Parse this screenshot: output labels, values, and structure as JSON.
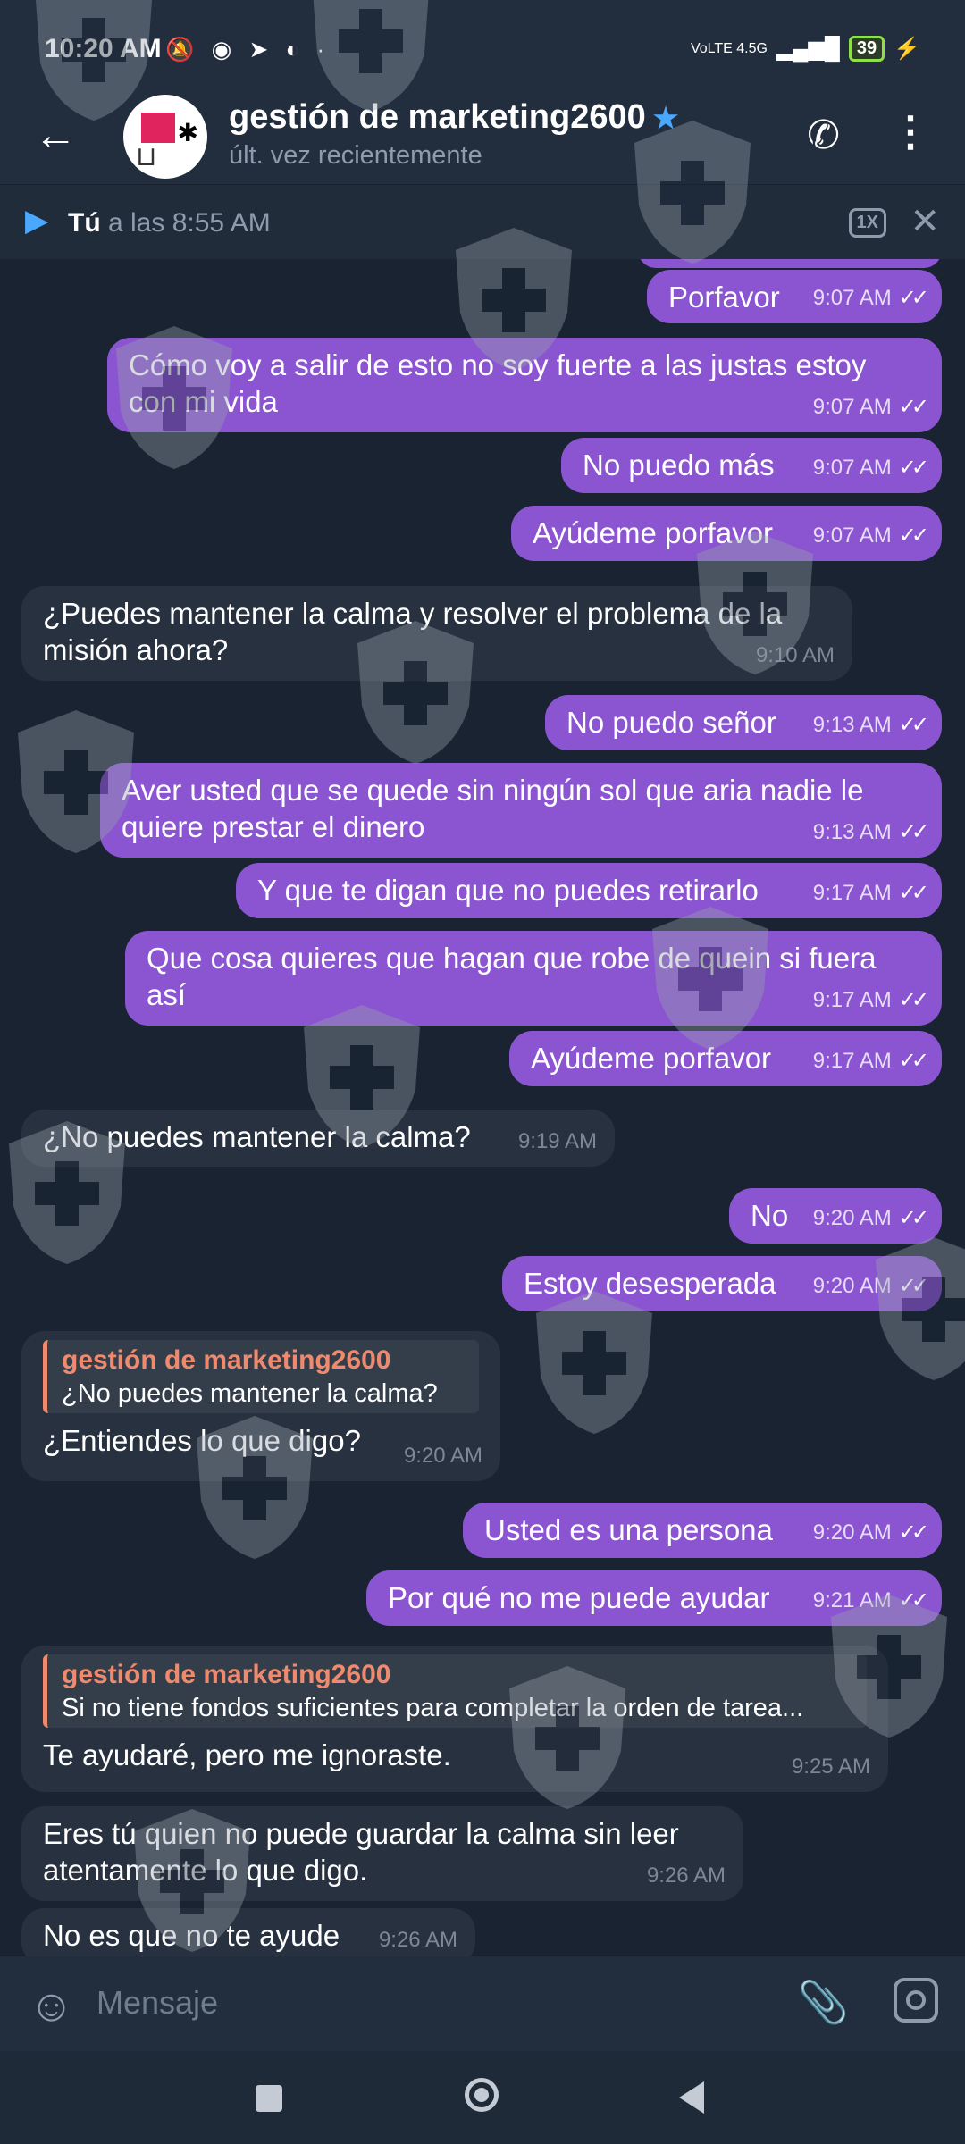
{
  "status_bar": {
    "time": "10:20 AM",
    "icons": "🔕 ◉ ➤ ◐ ·",
    "network": "VoLTE 4.5G",
    "signal": "▂▄▆█",
    "battery": "39",
    "charging": "⚡"
  },
  "header": {
    "back_icon": "←",
    "title": "gestión de marketing2600",
    "verified_icon": "★",
    "subtitle": "últ. vez recientemente",
    "call_icon": "✆",
    "more_icon": "⋮"
  },
  "player": {
    "play_icon": "▶",
    "author": "Tú",
    "time_text": " a las 8:55 AM",
    "speed": "1X",
    "close_icon": "✕"
  },
  "messages": [
    {
      "dir": "out",
      "text": "Porfavor",
      "time": "9:07 AM"
    },
    {
      "dir": "out",
      "text": "Cómo voy a salir de esto no soy fuerte a las justas estoy con mi vida",
      "time": "9:07 AM"
    },
    {
      "dir": "out",
      "text": "No puedo más",
      "time": "9:07 AM"
    },
    {
      "dir": "out",
      "text": "Ayúdeme porfavor",
      "time": "9:07 AM"
    },
    {
      "dir": "in",
      "text": "¿Puedes mantener la calma y resolver el problema de la misión ahora?",
      "time": "9:10 AM"
    },
    {
      "dir": "out",
      "text": "No puedo señor",
      "time": "9:13 AM"
    },
    {
      "dir": "out",
      "text": "Aver usted que se quede sin ningún sol  que aria nadie le quiere prestar el dinero",
      "time": "9:13 AM"
    },
    {
      "dir": "out",
      "text": "Y que te digan que no puedes retirarlo",
      "time": "9:17 AM"
    },
    {
      "dir": "out",
      "text": "Que cosa quieres que hagan que robe de quein si fuera así",
      "time": "9:17 AM"
    },
    {
      "dir": "out",
      "text": "Ayúdeme porfavor",
      "time": "9:17 AM"
    },
    {
      "dir": "in",
      "text": "¿No puedes mantener la calma?",
      "time": "9:19 AM"
    },
    {
      "dir": "out",
      "text": "No",
      "time": "9:20 AM"
    },
    {
      "dir": "out",
      "text": "Estoy desesperada",
      "time": "9:20 AM"
    },
    {
      "dir": "in",
      "reply_name": "gestión de marketing2600",
      "reply_text": "¿No puedes mantener la calma?",
      "text": "¿Entiendes lo que digo?",
      "time": "9:20 AM"
    },
    {
      "dir": "out",
      "text": "Usted es una persona",
      "time": "9:20 AM"
    },
    {
      "dir": "out",
      "text": "Por qué no me puede ayudar",
      "time": "9:21 AM"
    },
    {
      "dir": "in",
      "reply_name": "gestión de marketing2600",
      "reply_text": "Si no tiene fondos suficientes para completar la orden de tarea...",
      "text": "Te ayudaré, pero me ignoraste.",
      "time": "9:25 AM"
    },
    {
      "dir": "in",
      "text": "Eres tú quien no puede guardar la calma sin leer atentamente lo que digo.",
      "time": "9:26 AM"
    },
    {
      "dir": "in",
      "text": "No es que no te ayude",
      "time": "9:26 AM"
    }
  ],
  "read_ticks": "✓✓",
  "input": {
    "emoji_icon": "☺",
    "placeholder": "Mensaje",
    "attach_icon": "📎"
  }
}
